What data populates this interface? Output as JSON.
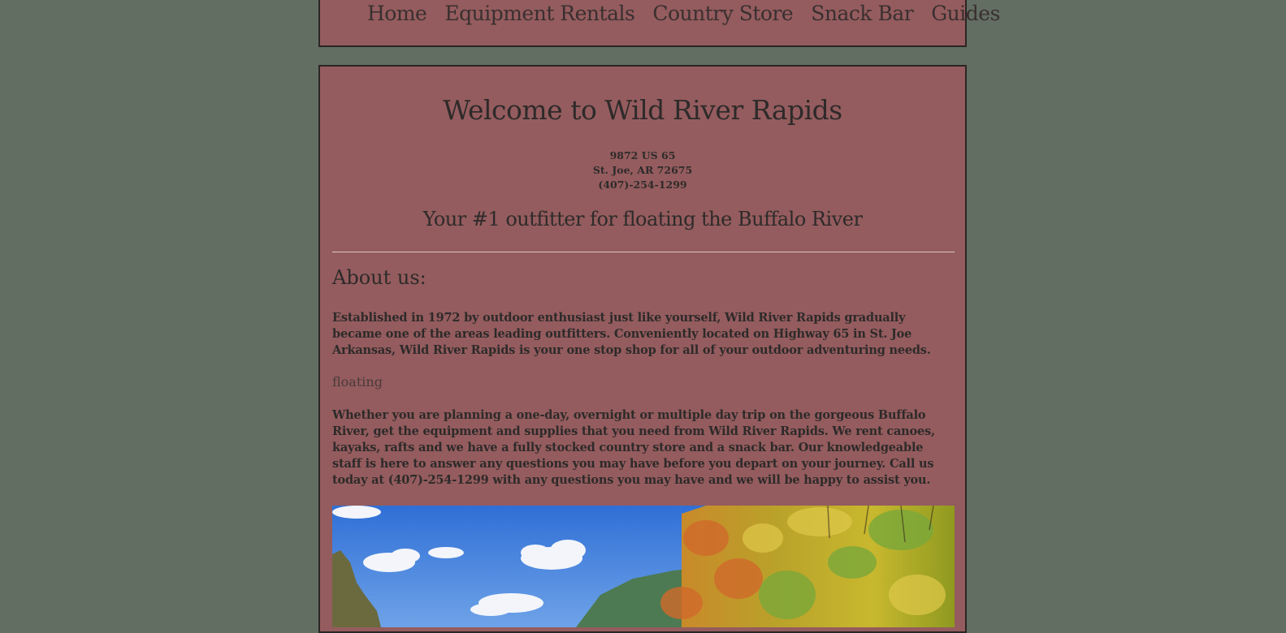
{
  "nav": {
    "items": [
      {
        "label": "Home"
      },
      {
        "label": "Equipment Rentals"
      },
      {
        "label": "Country Store"
      },
      {
        "label": "Snack Bar"
      },
      {
        "label": "Guides"
      }
    ]
  },
  "main": {
    "title": "Welcome to Wild River Rapids",
    "address": {
      "street": "9872 US 65",
      "city": "St. Joe, AR 72675",
      "phone": "(407)-254-1299"
    },
    "tagline": "Your #1 outfitter for floating the Buffalo River",
    "about_heading": "About us:",
    "paragraph_1": "Established in 1972 by outdoor enthusiast just like yourself, Wild River Rapids gradually became one of the areas leading outfitters. Conveniently located on Highway 65 in St. Joe Arkansas, Wild River Rapids is your one stop shop for all of your outdoor adventuring needs.",
    "image_alt_text": "floating",
    "paragraph_2": "Whether you are planning a one-day, overnight or multiple day trip on the gorgeous Buffalo River, get the equipment and supplies that you need from Wild River Rapids. We rent canoes, kayaks, rafts and we have a fully stocked country store and a snack bar. Our knowledgeable staff is here to answer any questions you may have before you depart on your journey. Call us today at (407)-254-1299 with any questions you may have and we will be happy to assist you."
  },
  "colors": {
    "page_background": "#626e61",
    "panel_background": "#945c5e",
    "panel_border": "#2b2525",
    "text": "#2e2a2a"
  }
}
